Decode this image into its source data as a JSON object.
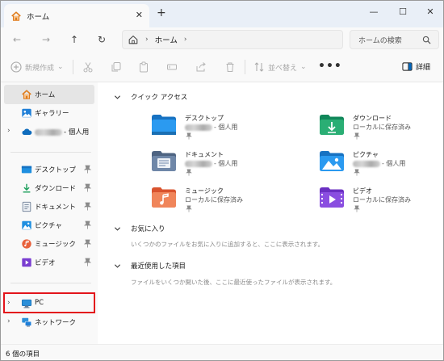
{
  "titlebar": {
    "tab_title": "ホーム",
    "close_symbol": "✕",
    "new_tab_symbol": "+",
    "minimize_symbol": "—",
    "maximize_symbol": "☐",
    "window_close_symbol": "✕"
  },
  "nav": {
    "back_symbol": "←",
    "forward_symbol": "→",
    "up_symbol": "↑",
    "refresh_symbol": "↻",
    "breadcrumb_sep": "›",
    "breadcrumb_current": "ホーム",
    "search_placeholder": "ホームの検索"
  },
  "commands": {
    "new_label": "新規作成",
    "new_caret": "⌄",
    "sort_label": "並べ替え",
    "sort_caret": "⌄",
    "more_label": "•••",
    "details_label": "詳細"
  },
  "sidebar": {
    "chevron": "›",
    "items": [
      {
        "label": "ホーム",
        "icon": "home-icon"
      },
      {
        "label": "ギャラリー",
        "icon": "gallery-icon"
      },
      {
        "label": "- 個人用",
        "icon": "onedrive-icon"
      },
      {
        "label": "デスクトップ",
        "icon": "desktop-folder-icon"
      },
      {
        "label": "ダウンロード",
        "icon": "download-icon"
      },
      {
        "label": "ドキュメント",
        "icon": "documents-icon"
      },
      {
        "label": "ピクチャ",
        "icon": "pictures-icon"
      },
      {
        "label": "ミュージック",
        "icon": "music-icon"
      },
      {
        "label": "ビデオ",
        "icon": "video-icon"
      },
      {
        "label": "PC",
        "icon": "pc-icon"
      },
      {
        "label": "ネットワーク",
        "icon": "network-icon"
      }
    ]
  },
  "main": {
    "quick_access": {
      "title": "クイック アクセス",
      "items": [
        {
          "name": "デスクトップ",
          "sub": "- 個人用",
          "icon": "desktop-folder-icon"
        },
        {
          "name": "ダウンロード",
          "sub": "ローカルに保存済み",
          "icon": "download-folder-icon"
        },
        {
          "name": "ドキュメント",
          "sub": "- 個人用",
          "icon": "documents-folder-icon"
        },
        {
          "name": "ピクチャ",
          "sub": "- 個人用",
          "icon": "pictures-folder-icon"
        },
        {
          "name": "ミュージック",
          "sub": "ローカルに保存済み",
          "icon": "music-folder-icon"
        },
        {
          "name": "ビデオ",
          "sub": "ローカルに保存済み",
          "icon": "videos-folder-icon"
        }
      ]
    },
    "favorites": {
      "title": "お気に入り",
      "text": "いくつかのファイルをお気に入りに追加すると、ここに表示されます。"
    },
    "recent": {
      "title": "最近使用した項目",
      "text": "ファイルをいくつか開いた後、ここに最近使ったファイルが表示されます。"
    }
  },
  "status": {
    "item_count": "6 個の項目"
  },
  "colors": {
    "highlight_border": "#e3141b",
    "selected_bg": "#e5e5e5",
    "accent": "#0067c0"
  }
}
